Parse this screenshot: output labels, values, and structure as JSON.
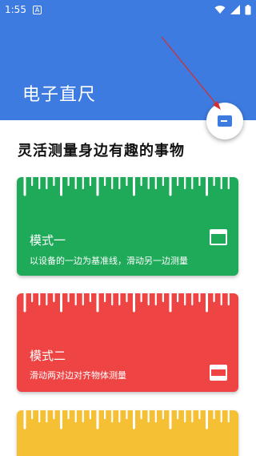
{
  "status_bar": {
    "time": "1:55",
    "notif_glyph": "A"
  },
  "app_bar": {
    "title": "电子直尺"
  },
  "subtitle": "灵活测量身边有趣的事物",
  "cards": [
    {
      "title": "模式一",
      "description": "以设备的一边为基准线，滑动另一边测量",
      "color": "#1faa59",
      "icon": "single-edge-ruler-icon"
    },
    {
      "title": "模式二",
      "description": "滑动两对边对齐物体测量",
      "color": "#ef4444",
      "icon": "double-edge-ruler-icon"
    },
    {
      "title": "",
      "description": "",
      "color": "#f6c035",
      "icon": ""
    }
  ],
  "colors": {
    "primary": "#3d7be0",
    "arrow": "#d32f2f"
  }
}
